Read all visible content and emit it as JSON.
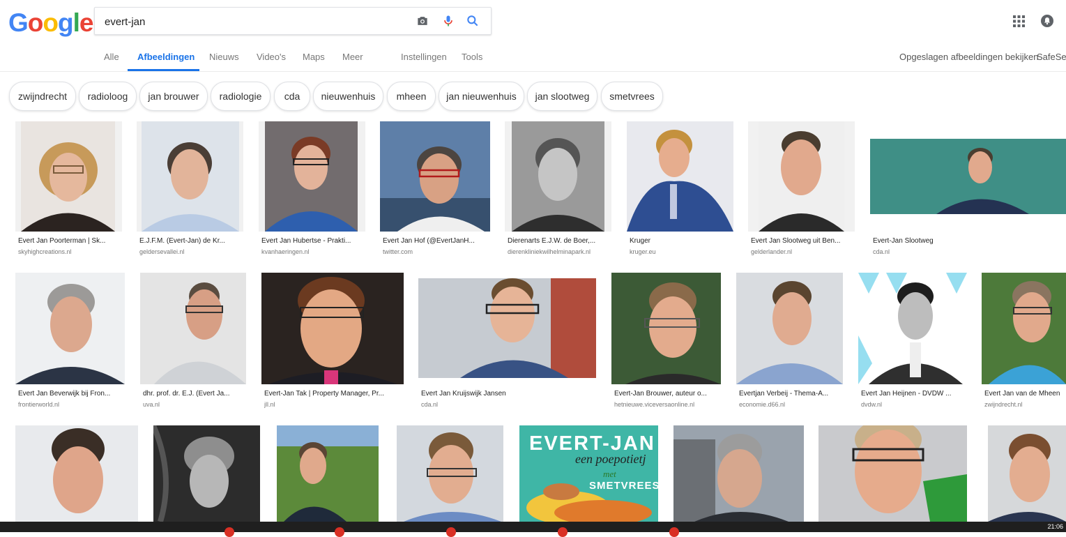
{
  "logo": {
    "letters": [
      "G",
      "o",
      "o",
      "g",
      "l",
      "e"
    ],
    "colors": [
      "#4285f4",
      "#ea4335",
      "#fbbc05",
      "#4285f4",
      "#34a853",
      "#ea4335"
    ]
  },
  "search": {
    "value": "evert-jan"
  },
  "icons": {
    "camera": "camera-icon",
    "mic": "mic-icon",
    "search": "search-icon",
    "apps": "apps-grid-icon",
    "notifications": "notifications-icon"
  },
  "tabs": [
    "Alle",
    "Afbeeldingen",
    "Nieuws",
    "Video's",
    "Maps",
    "Meer",
    "Instellingen",
    "Tools"
  ],
  "active_tab": "Afbeeldingen",
  "right_links": {
    "saved": "Opgeslagen afbeeldingen bekijken",
    "safesearch": "SafeSea"
  },
  "chips": [
    "zwijndrecht",
    "radioloog",
    "jan brouwer",
    "radiologie",
    "cda",
    "nieuwenhuis",
    "mheen",
    "jan nieuwenhuis",
    "jan slootweg",
    "smetvrees"
  ],
  "results_row1": [
    {
      "title": "Evert Jan Poorterman | Sk...",
      "source": "skyhighcreations.nl"
    },
    {
      "title": "E.J.F.M. (Evert-Jan) de Kr...",
      "source": "geldersevallei.nl"
    },
    {
      "title": "Evert Jan Hubertse - Prakti...",
      "source": "kvanhaeringen.nl"
    },
    {
      "title": "Evert Jan Hof (@EvertJanH...",
      "source": "twitter.com"
    },
    {
      "title": "Dierenarts E.J.W. de Boer,...",
      "source": "dierenkliniekwilhelminapark.nl"
    },
    {
      "title": "Kruger",
      "source": "kruger.eu"
    },
    {
      "title": "Evert Jan Slootweg uit Ben...",
      "source": "gelderlander.nl"
    },
    {
      "title": "Evert-Jan Slootweg",
      "source": "cda.nl"
    }
  ],
  "results_row2": [
    {
      "title": "Evert Jan Beverwijk bij Fron...",
      "source": "frontierworld.nl"
    },
    {
      "title": "dhr. prof. dr. E.J. (Evert Ja...",
      "source": "uva.nl"
    },
    {
      "title": "Evert-Jan Tak | Property Manager, Pr...",
      "source": "jll.nl"
    },
    {
      "title": "Evert Jan Kruijswijk Jansen",
      "source": "cda.nl"
    },
    {
      "title": "Evert-Jan Brouwer, auteur o...",
      "source": "hetnieuwe.viceversaonline.nl"
    },
    {
      "title": "Evertjan Verbeij - Thema-A...",
      "source": "economie.d66.nl"
    },
    {
      "title": "Evert Jan Heijnen - DVDW ...",
      "source": "dvdw.nl"
    },
    {
      "title": "Evert Jan van de Mheen",
      "source": "zwijndrecht.nl"
    }
  ],
  "row3_book": {
    "title_line": "EVERT-JAN",
    "subtitle": "een poepotietj",
    "word": "met",
    "brand": "SMETVREES"
  },
  "clock": "21:06"
}
